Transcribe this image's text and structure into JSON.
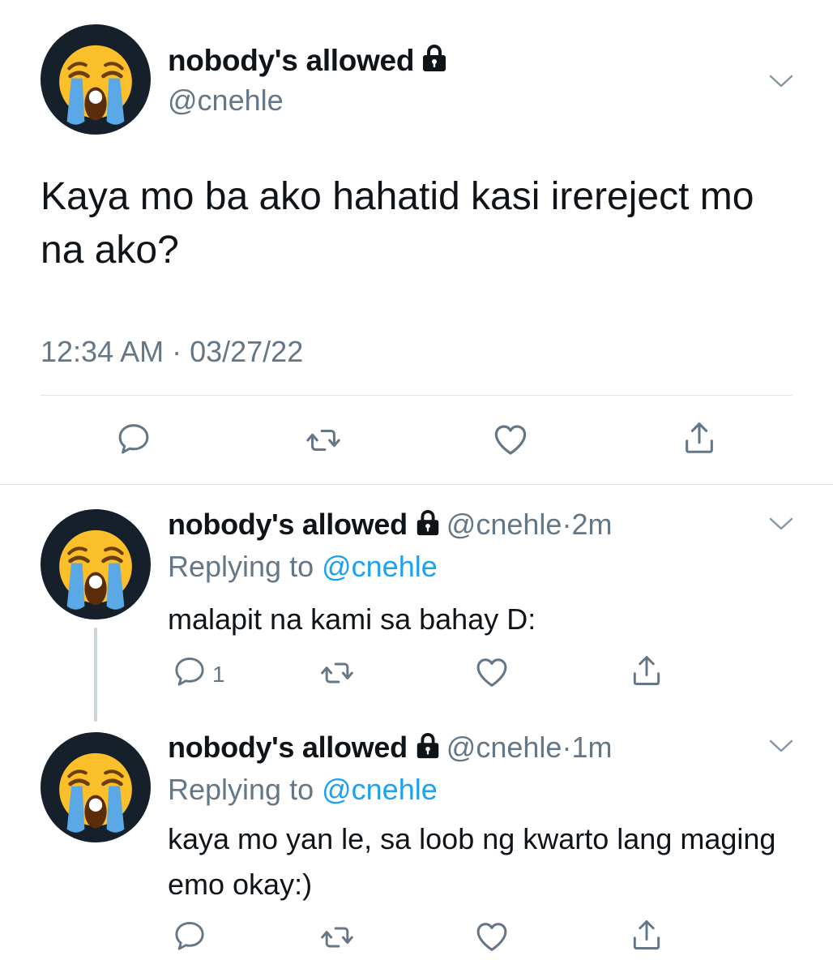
{
  "main_tweet": {
    "display_name": "nobody's allowed",
    "handle": "@cnehle",
    "text": "Kaya mo ba ako hahatid kasi irereject mo na ako?",
    "timestamp": "12:34 AM · 03/27/22",
    "avatar_icon": "crying-face-emoji",
    "protected_icon": "lock-icon",
    "actions": [
      "reply-icon",
      "retweet-icon",
      "like-icon",
      "share-icon"
    ]
  },
  "replies": [
    {
      "display_name": "nobody's allowed",
      "handle": "@cnehle",
      "dot": "·",
      "time": "2m",
      "replying_prefix": "Replying to ",
      "replying_to": "@cnehle",
      "text": "malapit na kami sa bahay D:",
      "reply_count": "1"
    },
    {
      "display_name": "nobody's allowed",
      "handle": "@cnehle",
      "dot": "·",
      "time": "1m",
      "replying_prefix": "Replying to ",
      "replying_to": "@cnehle",
      "text": "kaya mo yan le, sa loob ng kwarto lang maging emo okay:)",
      "reply_count": ""
    }
  ],
  "colors": {
    "text": "#0f1419",
    "secondary": "#657786",
    "mention": "#1da1f2",
    "divider": "#dfe3e7",
    "avatar_bg": "#15202b"
  }
}
